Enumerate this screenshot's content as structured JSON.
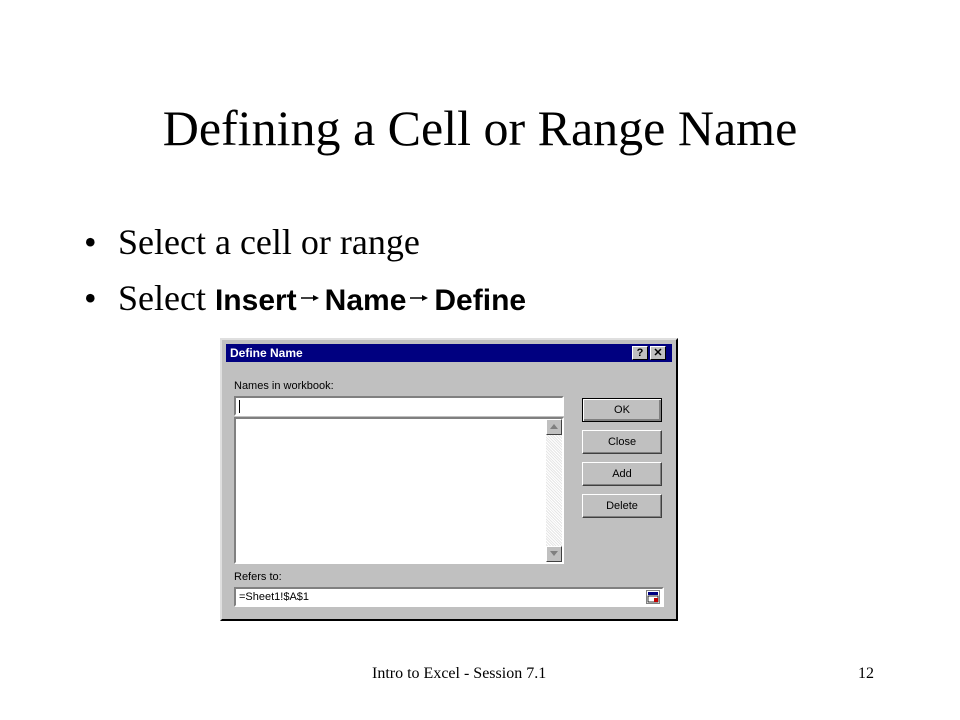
{
  "slide": {
    "title": "Defining a Cell or Range Name",
    "bullets": [
      {
        "text": "Select a cell or range"
      },
      {
        "text": "Select ",
        "path": [
          "Insert",
          "Name",
          "Define"
        ]
      }
    ],
    "footer": {
      "center": "Intro to Excel - Session 7.1",
      "page": "12"
    }
  },
  "dialog": {
    "title": "Define Name",
    "help_label": "?",
    "close_label": "✕",
    "names_label": "Names in workbook:",
    "name_value": "",
    "names_list": [],
    "refers_label": "Refers to:",
    "refers_value": "=Sheet1!$A$1",
    "buttons": {
      "ok": "OK",
      "close": "Close",
      "add": "Add",
      "delete": "Delete"
    }
  },
  "colors": {
    "titlebar": "#000080",
    "face": "#c0c0c0"
  }
}
